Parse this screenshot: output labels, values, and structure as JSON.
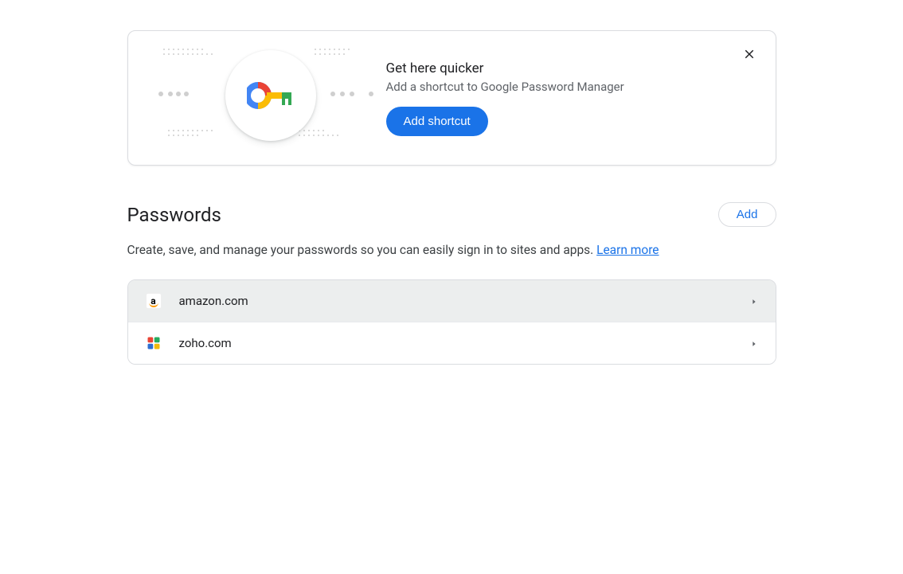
{
  "promo": {
    "title": "Get here quicker",
    "subtitle": "Add a shortcut to Google Password Manager",
    "button": "Add shortcut"
  },
  "section": {
    "title": "Passwords",
    "add_button": "Add",
    "description": "Create, save, and manage your passwords so you can easily sign in to sites and apps. ",
    "learn_more": "Learn more"
  },
  "passwords": [
    {
      "site": "amazon.com",
      "icon": "amazon"
    },
    {
      "site": "zoho.com",
      "icon": "zoho"
    }
  ]
}
